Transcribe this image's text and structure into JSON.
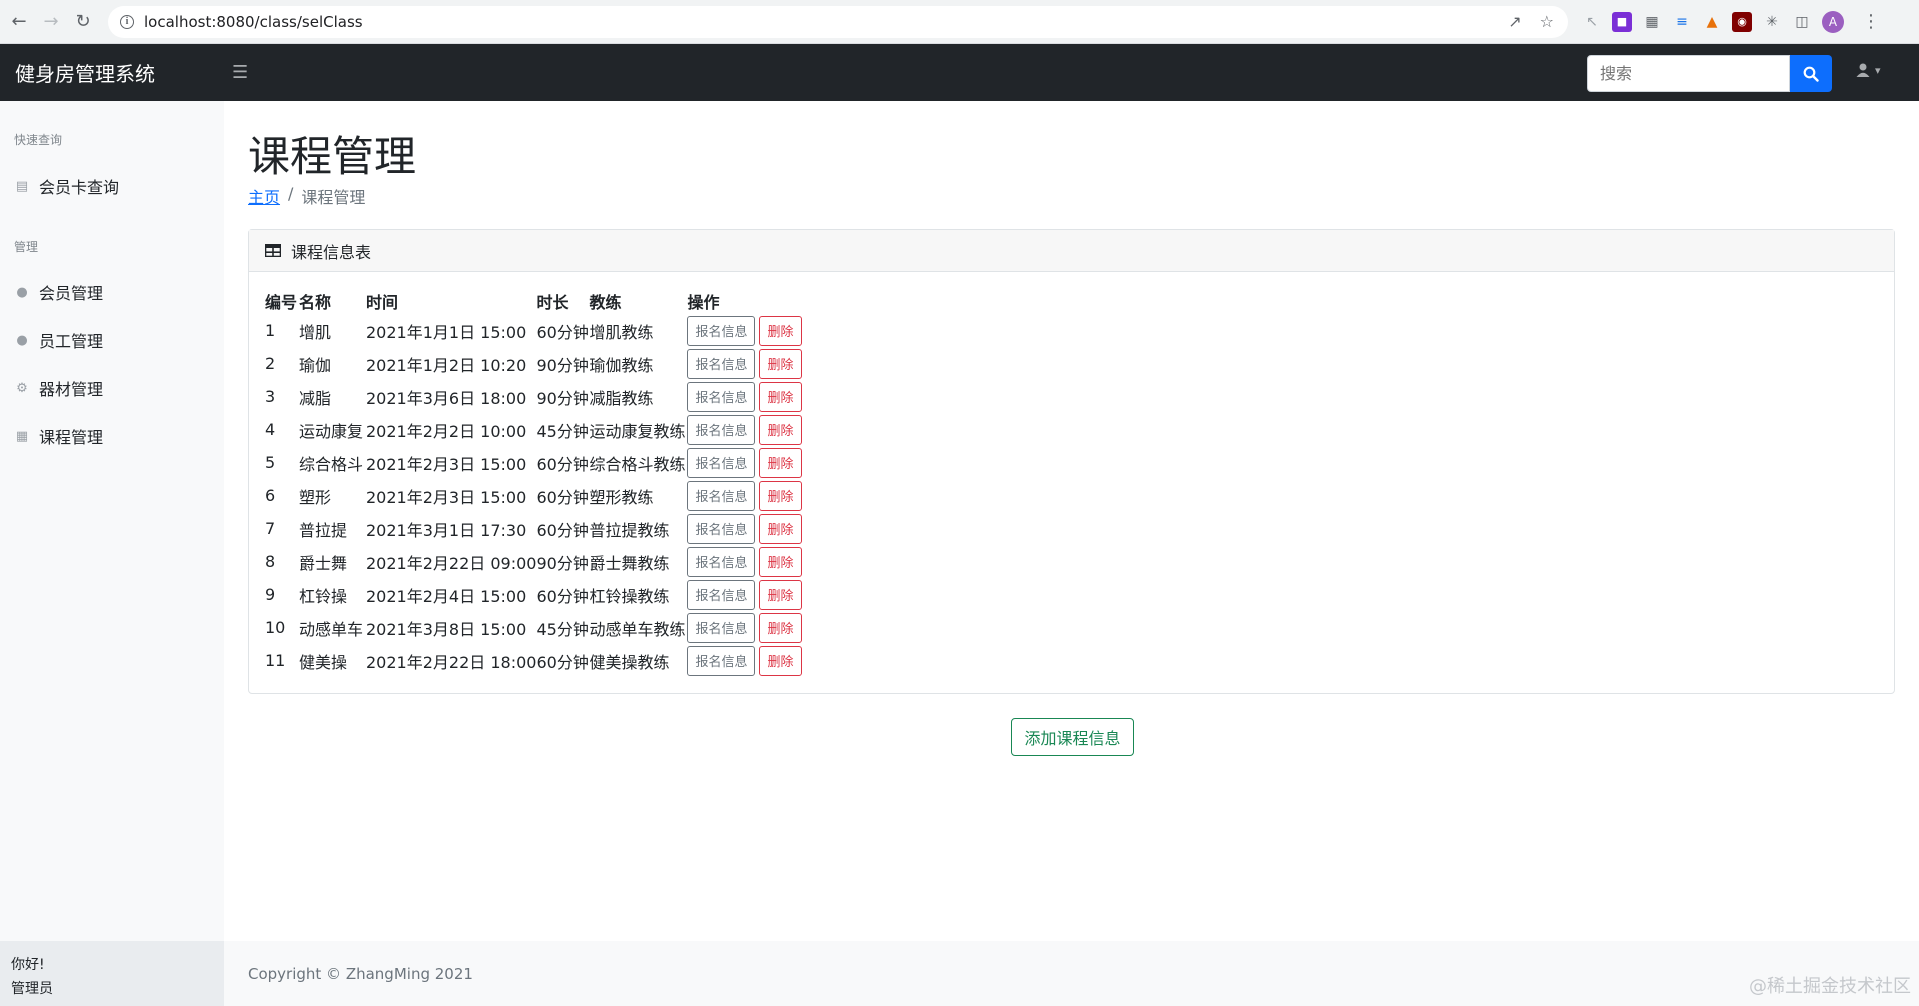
{
  "browser": {
    "url": "localhost:8080/class/selClass",
    "profile_initial": "A"
  },
  "app": {
    "brand": "健身房管理系统",
    "search_placeholder": "搜索"
  },
  "sidebar": {
    "quick_heading": "快速查询",
    "quick_items": [
      {
        "label": "会员卡查询",
        "icon": "id-card-icon"
      }
    ],
    "manage_heading": "管理",
    "manage_items": [
      {
        "label": "会员管理",
        "icon": "user-icon"
      },
      {
        "label": "员工管理",
        "icon": "user-icon"
      },
      {
        "label": "器材管理",
        "icon": "equipment-icon"
      },
      {
        "label": "课程管理",
        "icon": "table-icon"
      }
    ],
    "footer_greeting": "你好!",
    "footer_role": "管理员"
  },
  "main": {
    "title": "课程管理",
    "breadcrumb_home": "主页",
    "breadcrumb_current": "课程管理",
    "card_title": "课程信息表",
    "columns": [
      "编号",
      "名称",
      "时间",
      "时长",
      "教练",
      "操作"
    ],
    "info_button": "报名信息",
    "delete_button": "删除",
    "rows": [
      {
        "id": "1",
        "name": "增肌",
        "time": "2021年1月1日 15:00",
        "duration": "60分钟",
        "coach": "增肌教练"
      },
      {
        "id": "2",
        "name": "瑜伽",
        "time": "2021年1月2日 10:20",
        "duration": "90分钟",
        "coach": "瑜伽教练"
      },
      {
        "id": "3",
        "name": "减脂",
        "time": "2021年3月6日 18:00",
        "duration": "90分钟",
        "coach": "减脂教练"
      },
      {
        "id": "4",
        "name": "运动康复",
        "time": "2021年2月2日 10:00",
        "duration": "45分钟",
        "coach": "运动康复教练"
      },
      {
        "id": "5",
        "name": "综合格斗",
        "time": "2021年2月3日 15:00",
        "duration": "60分钟",
        "coach": "综合格斗教练"
      },
      {
        "id": "6",
        "name": "塑形",
        "time": "2021年2月3日 15:00",
        "duration": "60分钟",
        "coach": "塑形教练"
      },
      {
        "id": "7",
        "name": "普拉提",
        "time": "2021年3月1日 17:30",
        "duration": "60分钟",
        "coach": "普拉提教练"
      },
      {
        "id": "8",
        "name": "爵士舞",
        "time": "2021年2月22日 09:00",
        "duration": "90分钟",
        "coach": "爵士舞教练"
      },
      {
        "id": "9",
        "name": "杠铃操",
        "time": "2021年2月4日 15:00",
        "duration": "60分钟",
        "coach": "杠铃操教练"
      },
      {
        "id": "10",
        "name": "动感单车",
        "time": "2021年3月8日 15:00",
        "duration": "45分钟",
        "coach": "动感单车教练"
      },
      {
        "id": "11",
        "name": "健美操",
        "time": "2021年2月22日 18:00",
        "duration": "60分钟",
        "coach": "健美操教练"
      }
    ],
    "add_button": "添加课程信息",
    "copyright": "Copyright © ZhangMing 2021"
  },
  "watermark": "@稀土掘金技术社区",
  "colors": {
    "navbar": "#212529",
    "primary": "#0d6efd",
    "danger": "#dc3545",
    "success": "#198754",
    "secondary": "#6c757d"
  }
}
